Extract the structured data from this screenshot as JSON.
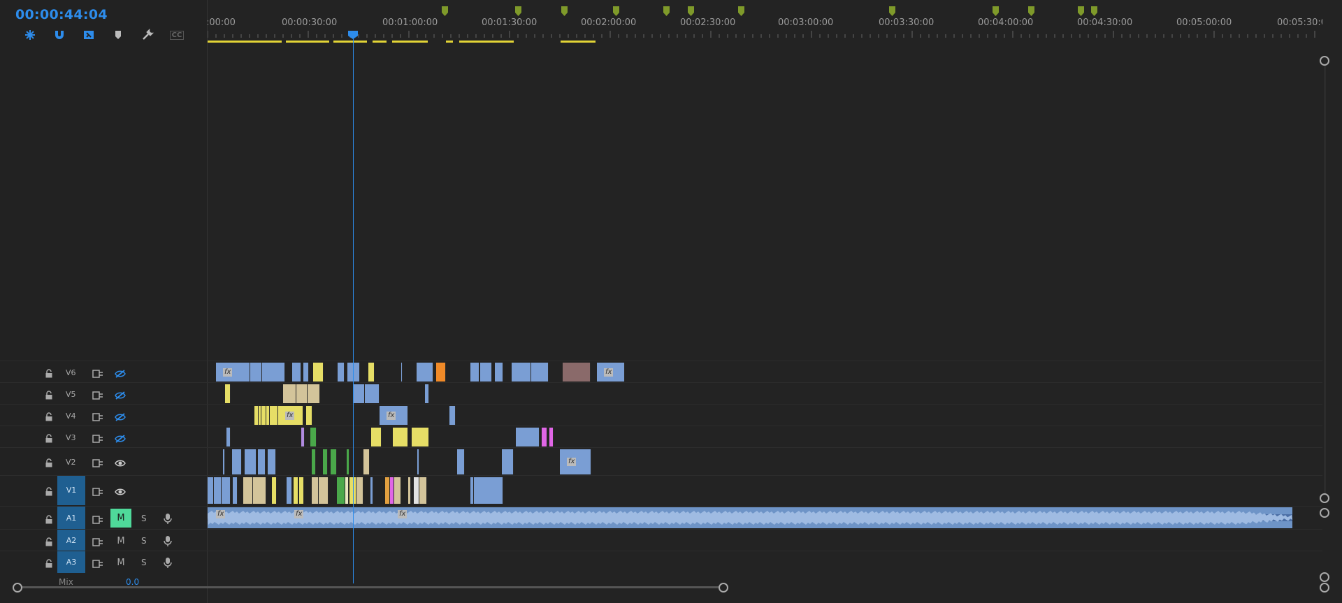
{
  "timecode": "00:00:44:04",
  "ruler_labels": [
    ":00:00",
    "00:00:30:00",
    "00:01:00:00",
    "00:01:30:00",
    "00:02:00:00",
    "00:02:30:00",
    "00:03:00:00",
    "00:03:30:00",
    "00:04:00:00",
    "00:04:30:00",
    "00:05:00:00",
    "00:05:30:0"
  ],
  "tools": [
    "snap-icon",
    "magnet-icon",
    "linked-selection-icon",
    "marker-icon",
    "wrench-icon",
    "captions-icon"
  ],
  "captions_label": "CC",
  "tracks": {
    "video": [
      {
        "name": "V6",
        "eye": "hidden"
      },
      {
        "name": "V5",
        "eye": "hidden"
      },
      {
        "name": "V4",
        "eye": "hidden"
      },
      {
        "name": "V3",
        "eye": "hidden"
      },
      {
        "name": "V2",
        "eye": "visible"
      },
      {
        "name": "V1",
        "eye": "visible",
        "target": true
      }
    ],
    "audio": [
      {
        "name": "A1",
        "mute": "M",
        "solo": "S",
        "mute_on": true,
        "target": true
      },
      {
        "name": "A2",
        "mute": "M",
        "solo": "S",
        "mute_on": false,
        "target": true
      },
      {
        "name": "A3",
        "mute": "M",
        "solo": "S",
        "mute_on": false,
        "target": true
      }
    ],
    "mix_label": "Mix",
    "mix_value": "0.0"
  },
  "fx_label": "fx",
  "colors": {
    "accent": "#2d8ceb",
    "clip_blue": "#7a9ed4",
    "clip_yellow": "#e6de66",
    "clip_tan": "#d3c49a",
    "clip_green": "#4aa84a",
    "clip_pink": "#e066e6",
    "clip_orange": "#f08a28",
    "mute_on": "#4fd99a"
  }
}
